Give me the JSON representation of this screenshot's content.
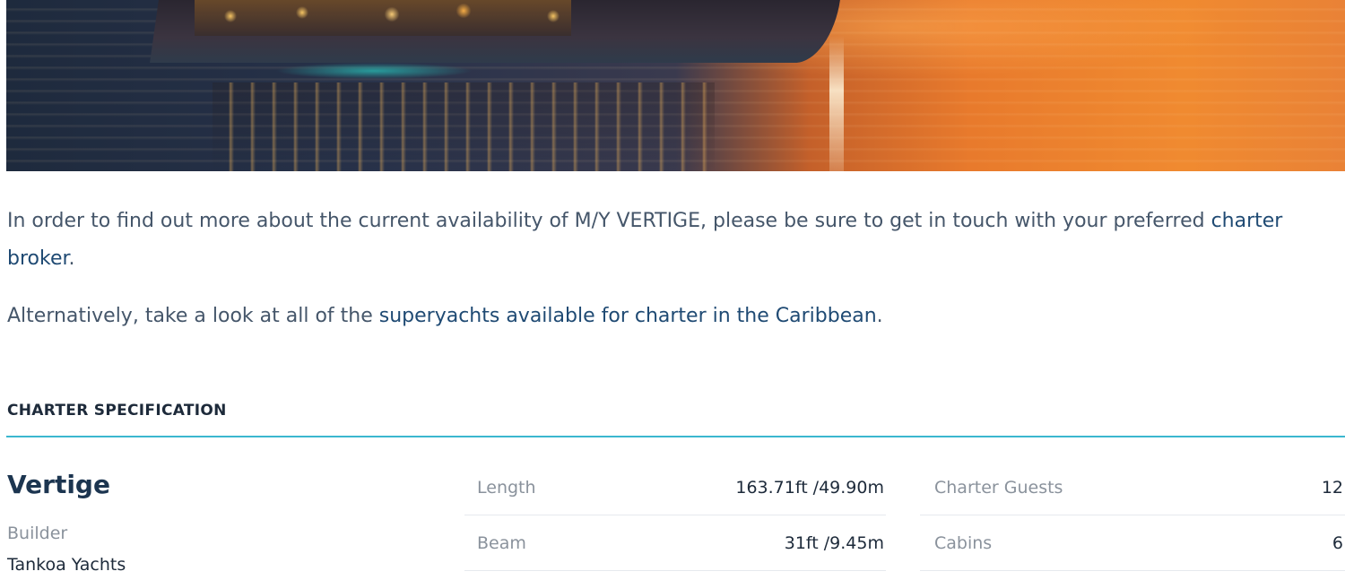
{
  "intro": {
    "before_link": "In order to find out more about the current availability of M/Y VERTIGE, please be sure to get in touch with your preferred ",
    "link_text": "charter broker",
    "after_link": "."
  },
  "alternative": {
    "before_link": "Alternatively, take a look at all of the ",
    "link_text": "superyachts available for charter in the Caribbean",
    "after_link": "."
  },
  "spec": {
    "heading": "CHARTER SPECIFICATION",
    "yacht_name": "Vertige",
    "builder_label": "Builder",
    "builder_value": "Tankoa Yachts",
    "rows": [
      {
        "label1": "Length",
        "value1": "163.71ft /49.90m",
        "label2": "Charter Guests",
        "value2": "12"
      },
      {
        "label1": "Beam",
        "value1": "31ft /9.45m",
        "label2": "Cabins",
        "value2": "6"
      }
    ]
  }
}
